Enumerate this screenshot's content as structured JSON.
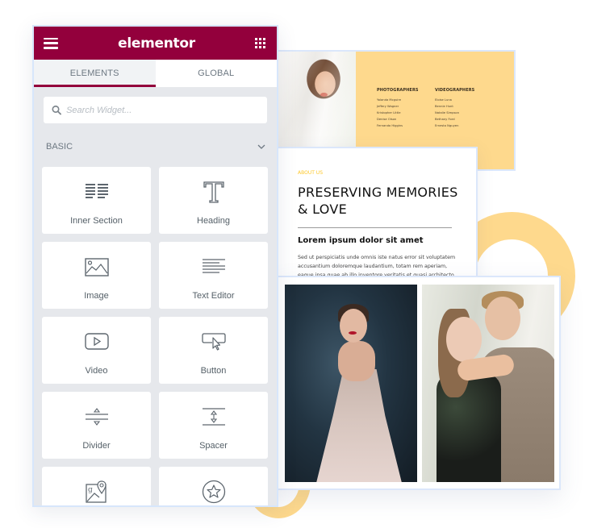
{
  "editor": {
    "brand": "elementor",
    "tabs": [
      {
        "label": "ELEMENTS",
        "active": true
      },
      {
        "label": "GLOBAL",
        "active": false
      }
    ],
    "search": {
      "placeholder": "Search Widget...",
      "value": ""
    },
    "category": {
      "label": "BASIC",
      "expanded": true
    },
    "widgets": [
      {
        "label": "Inner Section",
        "icon": "inner-section-icon"
      },
      {
        "label": "Heading",
        "icon": "heading-icon"
      },
      {
        "label": "Image",
        "icon": "image-icon"
      },
      {
        "label": "Text Editor",
        "icon": "text-editor-icon"
      },
      {
        "label": "Video",
        "icon": "video-icon"
      },
      {
        "label": "Button",
        "icon": "button-icon"
      },
      {
        "label": "Divider",
        "icon": "divider-icon"
      },
      {
        "label": "Spacer",
        "icon": "spacer-icon"
      },
      {
        "label": "",
        "icon": "google-maps-icon"
      },
      {
        "label": "",
        "icon": "star-icon"
      }
    ],
    "colors": {
      "brand": "#93003c",
      "panel_bg": "#e6e8ec",
      "accent_yellow": "#fed98d"
    }
  },
  "preview": {
    "team": {
      "photographers": {
        "heading": "PHOTOGRAPHERS",
        "names": [
          "Yolanda Mcguire",
          "Jeffery Wagner",
          "Kristopher Little",
          "Denise Olson",
          "Fernando Higgins"
        ]
      },
      "videographers": {
        "heading": "VIDEOGRAPHERS",
        "names": [
          "Eloise Luna",
          "Bennie Hunt",
          "Natalie Simpson",
          "Bethany Ford",
          "Ernesto Nguyen"
        ]
      }
    },
    "about": {
      "eyebrow": "ABOUT US",
      "title": "PRESERVING MEMORIES & LOVE",
      "subtitle": "Lorem ipsum dolor sit amet",
      "body": "Sed ut perspiciatis unde omnis iste natus error sit voluptatem accusantium doloremque laudantium, totam rem aperiam, eaque ipsa quae ab illo inventore veritatis et quasi architecto"
    }
  }
}
